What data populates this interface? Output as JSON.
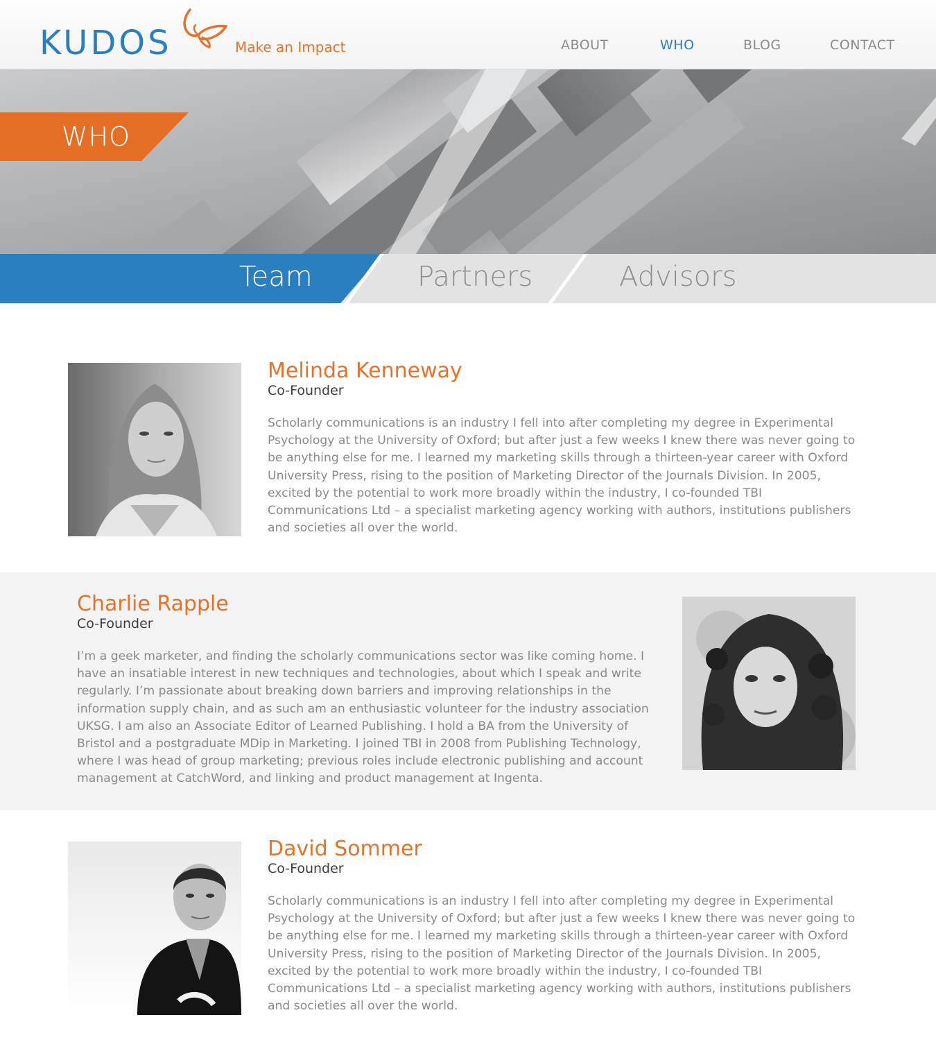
{
  "brand": {
    "logo_text": "KUDOS",
    "tagline": "Make an Impact",
    "primary_color": "#2a7fc0",
    "accent_color": "#e5732b"
  },
  "nav": {
    "items": [
      {
        "label": "ABOUT",
        "active": false
      },
      {
        "label": "WHO",
        "active": true
      },
      {
        "label": "BLOG",
        "active": false
      },
      {
        "label": "CONTACT",
        "active": false
      }
    ]
  },
  "hero": {
    "title": "WHO"
  },
  "tabs": [
    {
      "label": "Team",
      "active": true
    },
    {
      "label": "Partners",
      "active": false
    },
    {
      "label": "Advisors",
      "active": false
    }
  ],
  "team": [
    {
      "name": "Melinda Kenneway",
      "role": "Co-Founder",
      "photo_icon": "portrait-woman-straight-hair",
      "bio": "Scholarly communications is an industry I fell into after completing my degree in Experimental Psychology at the University of Oxford; but after just a few weeks I knew there was never going to be anything else for me. I learned my marketing skills through a thirteen-year career with Oxford University Press, rising to the position of Marketing Director of the Journals Division. In 2005, excited by the potential to work more broadly within the industry, I co-founded TBI Communications Ltd – a specialist marketing agency working with authors, institutions publishers and societies all over the world."
    },
    {
      "name": "Charlie Rapple",
      "role": "Co-Founder",
      "photo_icon": "portrait-woman-curly-hair",
      "bio": "I’m a geek marketer, and finding the scholarly communications sector was like coming home. I have an insatiable interest in new techniques and technologies, about which I speak and write regularly. I’m passionate about breaking down barriers and improving relationships in the information supply chain, and as such am an enthusiastic volunteer for the industry association UKSG. I am also an Associate Editor of Learned Publishing. I hold a BA from the University of Bristol and a postgraduate MDip in Marketing. I joined TBI in 2008 from Publishing Technology, where I was head of group marketing; previous roles include electronic publishing and account management at CatchWord, and linking and product management at Ingenta."
    },
    {
      "name": "David Sommer",
      "role": "Co-Founder",
      "photo_icon": "portrait-man-suit",
      "bio": "Scholarly communications is an industry I fell into after completing my degree in Experimental Psychology at the University of Oxford; but after just a few weeks I knew there was never going to be anything else for me. I learned my marketing skills through a thirteen-year career with Oxford University Press, rising to the position of Marketing Director of the Journals Division. In 2005, excited by the potential to work more broadly within the industry, I co-founded TBI Communications Ltd – a specialist marketing agency working with authors, institutions publishers and societies all over the world."
    }
  ]
}
